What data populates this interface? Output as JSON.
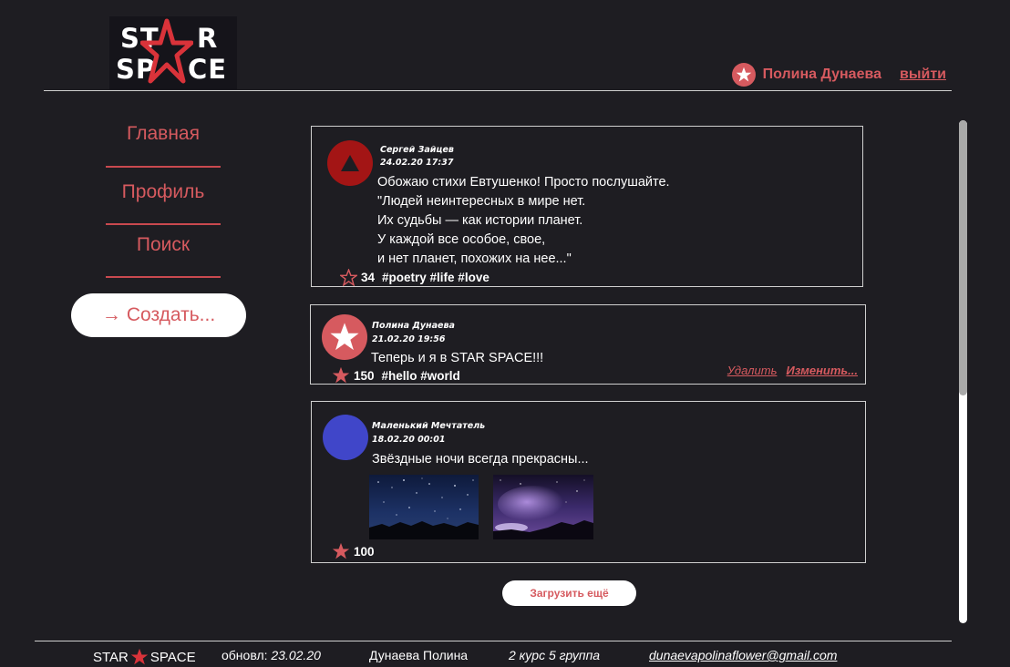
{
  "brand": {
    "logo_line1_left": "ST",
    "logo_line1_right": "R",
    "logo_line2_left": "SP",
    "logo_line2_right": "CE",
    "footer_left": "STAR",
    "footer_right": "SPACE",
    "accent_color": "#d65a5f"
  },
  "header": {
    "user_name": "Полина Дунаева",
    "logout_label": "выйти",
    "user_icon": "star-icon"
  },
  "sidebar": {
    "items": [
      {
        "label": "Главная"
      },
      {
        "label": "Профиль"
      },
      {
        "label": "Поиск"
      }
    ],
    "create_label": "Создать...",
    "create_icon": "arrow-right-icon"
  },
  "feed": {
    "posts": [
      {
        "author": "Сергей Зайцев",
        "date": "24.02.20 17:37",
        "avatar_color": "#a31515",
        "avatar_icon": "triangle-icon",
        "text_lines": [
          "Обожаю стихи Евтушенко! Просто послушайте.",
          "\"Людей неинтересных в мире нет.",
          "Их судьбы — как истории планет.",
          "У каждой все особое, свое,",
          "и нет планет, похожих на нее...\""
        ],
        "likes": "34",
        "liked": false,
        "tags": "#poetry #life #love"
      },
      {
        "author": "Полина Дунаева",
        "date": "21.02.20 19:56",
        "avatar_color": "#d65a5f",
        "avatar_icon": "star-icon",
        "text_lines": [
          "Теперь и я в STAR SPACE!!!"
        ],
        "likes": "150",
        "liked": true,
        "tags": "#hello #world",
        "delete_label": "Удалить",
        "edit_label": "Изменить..."
      },
      {
        "author": "Маленький Мечтатель",
        "date": "18.02.20 00:01",
        "avatar_color": "#4046c9",
        "text_lines": [
          "Звёздные ночи всегда прекрасны..."
        ],
        "likes": "100",
        "liked": true,
        "images": [
          "night-sky-photo",
          "aurora-photo"
        ]
      }
    ],
    "load_more_label": "Загрузить ещё"
  },
  "footer": {
    "updated_label": "обновл:",
    "updated_date": "23.02.20",
    "author": "Дунаева Полина",
    "course": "2 курс 5 группа",
    "email": "dunaevapolinaflower@gmail.com"
  }
}
